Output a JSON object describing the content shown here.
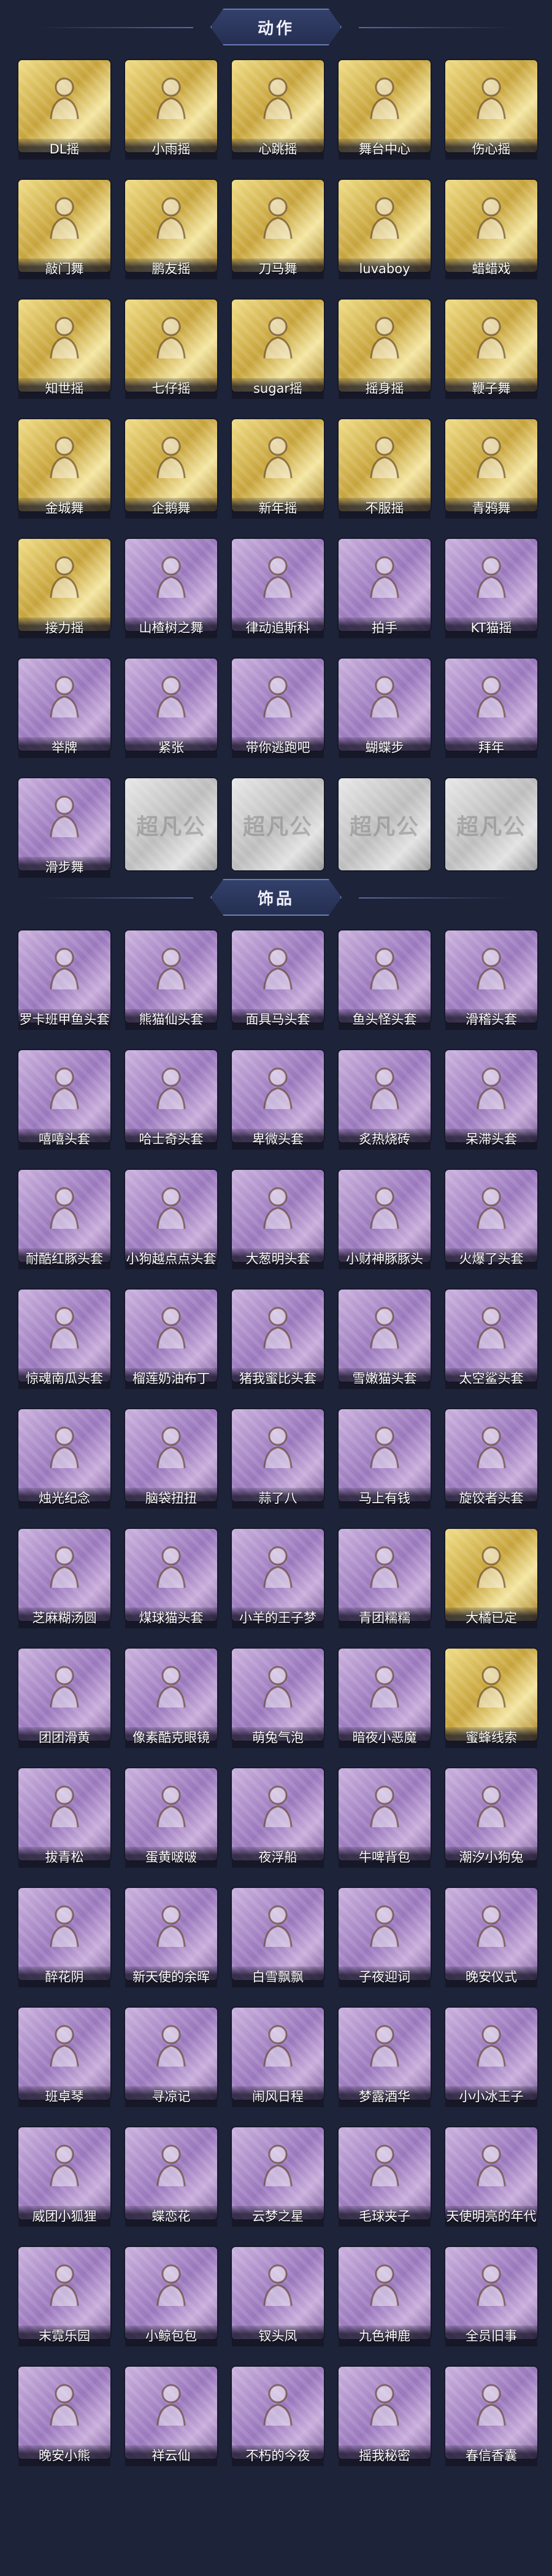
{
  "colors": {
    "background": "#1d2338",
    "gold_card": "#d9bb55",
    "purple_card": "#a888c8",
    "gray_card": "#cfcfcf"
  },
  "sections": [
    {
      "title": "动作",
      "items": [
        {
          "label": "DL摇",
          "rarity": "gold",
          "icon": "pose-icon"
        },
        {
          "label": "小雨摇",
          "rarity": "gold",
          "icon": "pose-icon"
        },
        {
          "label": "心跳摇",
          "rarity": "gold",
          "icon": "pose-icon"
        },
        {
          "label": "舞台中心",
          "rarity": "gold",
          "icon": "pose-icon"
        },
        {
          "label": "伤心摇",
          "rarity": "gold",
          "icon": "pose-icon"
        },
        {
          "label": "敲门舞",
          "rarity": "gold",
          "icon": "pose-icon"
        },
        {
          "label": "鹏友摇",
          "rarity": "gold",
          "icon": "pose-icon"
        },
        {
          "label": "刀马舞",
          "rarity": "gold",
          "icon": "pose-icon"
        },
        {
          "label": "luvaboy",
          "rarity": "gold",
          "icon": "pose-icon"
        },
        {
          "label": "蜡蜡戏",
          "rarity": "gold",
          "icon": "pose-icon"
        },
        {
          "label": "知世摇",
          "rarity": "gold",
          "icon": "pose-icon"
        },
        {
          "label": "七仔摇",
          "rarity": "gold",
          "icon": "pose-icon"
        },
        {
          "label": "sugar摇",
          "rarity": "gold",
          "icon": "pose-icon"
        },
        {
          "label": "摇身摇",
          "rarity": "gold",
          "icon": "pose-icon"
        },
        {
          "label": "鞭子舞",
          "rarity": "gold",
          "icon": "pose-icon"
        },
        {
          "label": "金城舞",
          "rarity": "gold",
          "icon": "pose-icon"
        },
        {
          "label": "企鹅舞",
          "rarity": "gold",
          "icon": "pose-icon"
        },
        {
          "label": "新年摇",
          "rarity": "gold",
          "icon": "pose-icon"
        },
        {
          "label": "不服摇",
          "rarity": "gold",
          "icon": "pose-icon"
        },
        {
          "label": "青鸦舞",
          "rarity": "gold",
          "icon": "pose-icon"
        },
        {
          "label": "接力摇",
          "rarity": "gold",
          "icon": "pose-icon"
        },
        {
          "label": "山楂树之舞",
          "rarity": "purple",
          "icon": "pose-icon"
        },
        {
          "label": "律动追斯科",
          "rarity": "purple",
          "icon": "pose-icon"
        },
        {
          "label": "拍手",
          "rarity": "purple",
          "icon": "pose-icon"
        },
        {
          "label": "KT猫摇",
          "rarity": "purple",
          "icon": "pose-icon"
        },
        {
          "label": "举牌",
          "rarity": "purple",
          "icon": "pose-icon"
        },
        {
          "label": "紧张",
          "rarity": "purple",
          "icon": "pose-icon"
        },
        {
          "label": "带你逃跑吧",
          "rarity": "purple",
          "icon": "pose-icon"
        },
        {
          "label": "蝴蝶步",
          "rarity": "purple",
          "icon": "pose-icon"
        },
        {
          "label": "拜年",
          "rarity": "purple",
          "icon": "pose-icon"
        },
        {
          "label": "滑步舞",
          "rarity": "purple",
          "icon": "pose-icon"
        },
        {
          "label": "",
          "rarity": "gray",
          "icon": "placeholder-icon",
          "watermark": "超凡公"
        },
        {
          "label": "",
          "rarity": "gray",
          "icon": "placeholder-icon",
          "watermark": "超凡公"
        },
        {
          "label": "",
          "rarity": "gray",
          "icon": "placeholder-icon",
          "watermark": "超凡公"
        },
        {
          "label": "",
          "rarity": "gray",
          "icon": "placeholder-icon",
          "watermark": "超凡公"
        }
      ]
    },
    {
      "title": "饰品",
      "items": [
        {
          "label": "罗卡班甲鱼头套",
          "rarity": "purple",
          "icon": "mask-icon"
        },
        {
          "label": "熊猫仙头套",
          "rarity": "purple",
          "icon": "mask-icon"
        },
        {
          "label": "面具马头套",
          "rarity": "purple",
          "icon": "mask-icon"
        },
        {
          "label": "鱼头怪头套",
          "rarity": "purple",
          "icon": "mask-icon"
        },
        {
          "label": "滑稽头套",
          "rarity": "purple",
          "icon": "mask-icon"
        },
        {
          "label": "嘻嘻头套",
          "rarity": "purple",
          "icon": "mask-icon"
        },
        {
          "label": "哈士奇头套",
          "rarity": "purple",
          "icon": "mask-icon"
        },
        {
          "label": "卑微头套",
          "rarity": "purple",
          "icon": "mask-icon"
        },
        {
          "label": "炙热烧砖",
          "rarity": "purple",
          "icon": "mask-icon"
        },
        {
          "label": "呆滞头套",
          "rarity": "purple",
          "icon": "mask-icon"
        },
        {
          "label": "耐酷红豚头套",
          "rarity": "purple",
          "icon": "mask-icon"
        },
        {
          "label": "小狗越点点头套",
          "rarity": "purple",
          "icon": "mask-icon"
        },
        {
          "label": "大葱明头套",
          "rarity": "purple",
          "icon": "mask-icon"
        },
        {
          "label": "小财神豚豚头",
          "rarity": "purple",
          "icon": "mask-icon"
        },
        {
          "label": "火爆了头套",
          "rarity": "purple",
          "icon": "mask-icon"
        },
        {
          "label": "惊魂南瓜头套",
          "rarity": "purple",
          "icon": "mask-icon"
        },
        {
          "label": "榴莲奶油布丁",
          "rarity": "purple",
          "icon": "mask-icon"
        },
        {
          "label": "猪我蜜比头套",
          "rarity": "purple",
          "icon": "mask-icon"
        },
        {
          "label": "雪嫩猫头套",
          "rarity": "purple",
          "icon": "mask-icon"
        },
        {
          "label": "太空鲨头套",
          "rarity": "purple",
          "icon": "mask-icon"
        },
        {
          "label": "烛光纪念",
          "rarity": "purple",
          "icon": "mask-icon"
        },
        {
          "label": "脑袋扭扭",
          "rarity": "purple",
          "icon": "mask-icon"
        },
        {
          "label": "蒜了八",
          "rarity": "purple",
          "icon": "mask-icon"
        },
        {
          "label": "马上有钱",
          "rarity": "purple",
          "icon": "mask-icon"
        },
        {
          "label": "旋饺者头套",
          "rarity": "purple",
          "icon": "mask-icon"
        },
        {
          "label": "芝麻糊汤圆",
          "rarity": "purple",
          "icon": "mask-icon"
        },
        {
          "label": "煤球猫头套",
          "rarity": "purple",
          "icon": "mask-icon"
        },
        {
          "label": "小羊的王子梦",
          "rarity": "purple",
          "icon": "mask-icon"
        },
        {
          "label": "青团糯糯",
          "rarity": "purple",
          "icon": "mask-icon"
        },
        {
          "label": "大橘已定",
          "rarity": "gold",
          "icon": "mask-icon"
        },
        {
          "label": "团团滑黄",
          "rarity": "purple",
          "icon": "mask-icon"
        },
        {
          "label": "像素酷克眼镜",
          "rarity": "purple",
          "icon": "mask-icon"
        },
        {
          "label": "萌兔气泡",
          "rarity": "purple",
          "icon": "mask-icon"
        },
        {
          "label": "暗夜小恶魔",
          "rarity": "purple",
          "icon": "mask-icon"
        },
        {
          "label": "蜜蜂线索",
          "rarity": "gold",
          "icon": "mask-icon"
        },
        {
          "label": "拔青松",
          "rarity": "purple",
          "icon": "mask-icon"
        },
        {
          "label": "蛋黄啵啵",
          "rarity": "purple",
          "icon": "mask-icon"
        },
        {
          "label": "夜浮船",
          "rarity": "purple",
          "icon": "mask-icon"
        },
        {
          "label": "牛啤背包",
          "rarity": "purple",
          "icon": "mask-icon"
        },
        {
          "label": "潮汐小狗兔",
          "rarity": "purple",
          "icon": "mask-icon"
        },
        {
          "label": "醉花阴",
          "rarity": "purple",
          "icon": "mask-icon"
        },
        {
          "label": "新天使的余晖",
          "rarity": "purple",
          "icon": "mask-icon"
        },
        {
          "label": "白雪飘飘",
          "rarity": "purple",
          "icon": "mask-icon"
        },
        {
          "label": "子夜迎词",
          "rarity": "purple",
          "icon": "mask-icon"
        },
        {
          "label": "晚安仪式",
          "rarity": "purple",
          "icon": "mask-icon"
        },
        {
          "label": "班卓琴",
          "rarity": "purple",
          "icon": "mask-icon"
        },
        {
          "label": "寻凉记",
          "rarity": "purple",
          "icon": "mask-icon"
        },
        {
          "label": "闹风日程",
          "rarity": "purple",
          "icon": "mask-icon"
        },
        {
          "label": "梦露酒华",
          "rarity": "purple",
          "icon": "mask-icon"
        },
        {
          "label": "小小冰王子",
          "rarity": "purple",
          "icon": "mask-icon"
        },
        {
          "label": "威团小狐狸",
          "rarity": "purple",
          "icon": "mask-icon"
        },
        {
          "label": "蝶恋花",
          "rarity": "purple",
          "icon": "mask-icon"
        },
        {
          "label": "云梦之星",
          "rarity": "purple",
          "icon": "mask-icon"
        },
        {
          "label": "毛球夹子",
          "rarity": "purple",
          "icon": "mask-icon"
        },
        {
          "label": "天使明亮的年代",
          "rarity": "purple",
          "icon": "mask-icon"
        },
        {
          "label": "末霓乐园",
          "rarity": "purple",
          "icon": "mask-icon"
        },
        {
          "label": "小鲸包包",
          "rarity": "purple",
          "icon": "mask-icon"
        },
        {
          "label": "钗头凤",
          "rarity": "purple",
          "icon": "mask-icon"
        },
        {
          "label": "九色神鹿",
          "rarity": "purple",
          "icon": "mask-icon"
        },
        {
          "label": "全员旧事",
          "rarity": "purple",
          "icon": "mask-icon"
        },
        {
          "label": "晚安小熊",
          "rarity": "purple",
          "icon": "mask-icon"
        },
        {
          "label": "祥云仙",
          "rarity": "purple",
          "icon": "mask-icon"
        },
        {
          "label": "不朽的今夜",
          "rarity": "purple",
          "icon": "mask-icon"
        },
        {
          "label": "摇我秘密",
          "rarity": "purple",
          "icon": "mask-icon"
        },
        {
          "label": "春信香囊",
          "rarity": "purple",
          "icon": "mask-icon"
        }
      ]
    }
  ]
}
